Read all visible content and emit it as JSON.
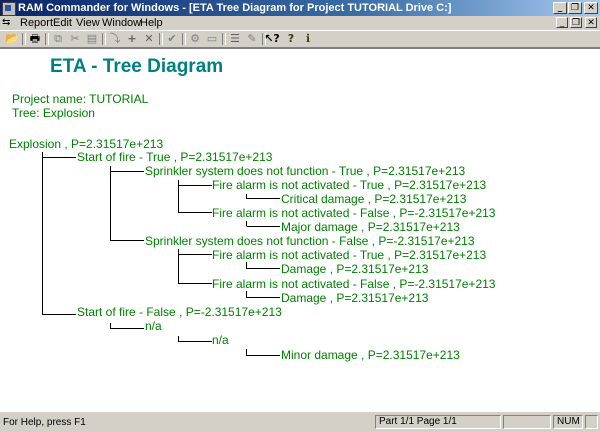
{
  "window": {
    "title": "RAM Commander for Windows - [ETA Tree Diagram for Project TUTORIAL Drive C:]",
    "minimize": "_",
    "restore": "❐",
    "close": "✕"
  },
  "menu": [
    "Report",
    "Edit",
    "View",
    "Window",
    "Help"
  ],
  "heading": "ETA - Tree Diagram",
  "project": "Project name: TUTORIAL",
  "tree": "Tree: Explosion",
  "nodes": [
    "Explosion , P=2.31517e+213",
    "Start of fire - True , P=2.31517e+213",
    "Sprinkler system does not function - True , P=2.31517e+213",
    "Fire alarm is not activated - True , P=2.31517e+213",
    "Critical damage , P=2.31517e+213",
    "Fire alarm is not activated - False , P=-2.31517e+213",
    "Major damage , P=2.31517e+213",
    "Sprinkler system does not function - False , P=-2.31517e+213",
    "Fire alarm is not activated - True , P=2.31517e+213",
    "Damage , P=2.31517e+213",
    "Fire alarm is not activated - False , P=-2.31517e+213",
    "Damage , P=2.31517e+213",
    "Start of fire - False , P=-2.31517e+213",
    "n/a",
    "n/a",
    "Minor damage , P=2.31517e+213"
  ],
  "status": {
    "help": "For Help, press F1",
    "page": "Part 1/1 Page 1/1",
    "num": "NUM"
  },
  "colors": {
    "tree_text": "#008000",
    "heading": "#008080"
  }
}
